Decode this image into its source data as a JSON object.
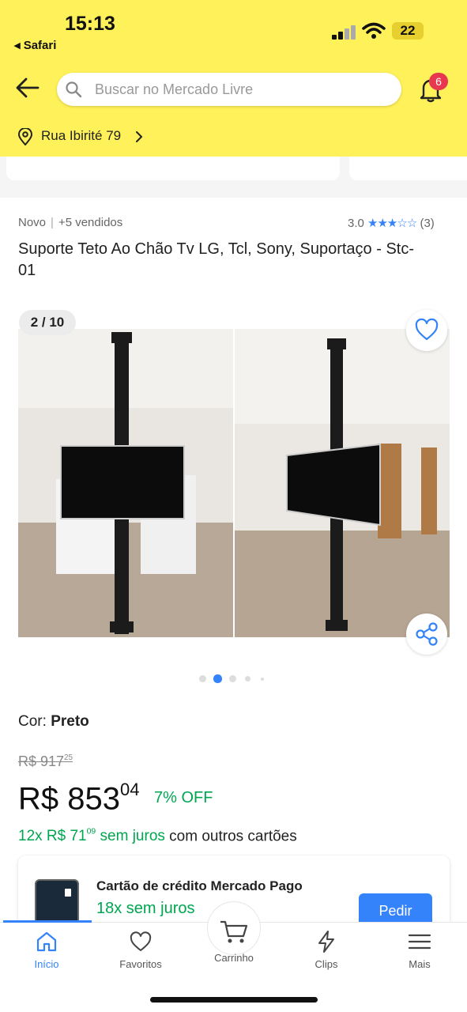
{
  "status_bar": {
    "time": "15:13",
    "back_app": "◂ Safari",
    "battery": "22"
  },
  "header": {
    "search_placeholder": "Buscar no Mercado Livre",
    "notification_count": "6",
    "location": "Rua Ibirité 79"
  },
  "product": {
    "condition": "Novo",
    "sold": "+5 vendidos",
    "rating_value": "3.0",
    "rating_stars": "★★★☆☆",
    "rating_count": "(3)",
    "title": "Suporte Teto Ao Chão Tv LG, Tcl, Sony,  Suportaço - Stc-01",
    "image_counter": "2 / 10",
    "color_label": "Cor:",
    "color_value": "Preto",
    "old_price_int": "R$ 917",
    "old_price_cents": "25",
    "price_int": "R$ 853",
    "price_cents": "04",
    "discount": "7% OFF",
    "installments_prefix": "12x R$ 71",
    "installments_cents": "09",
    "installments_green": "sem juros",
    "installments_suffix": "com outros cartões"
  },
  "credit_card": {
    "title": "Cartão de crédito Mercado Pago",
    "subtitle": "18x sem juros",
    "button": "Pedir"
  },
  "tabbar": {
    "home": "Início",
    "favorites": "Favoritos",
    "cart": "Carrinho",
    "clips": "Clips",
    "more": "Mais"
  },
  "colors": {
    "brand_yellow": "#fff159",
    "accent_blue": "#3483fa",
    "green": "#00a650",
    "badge_red": "#e8384f"
  }
}
